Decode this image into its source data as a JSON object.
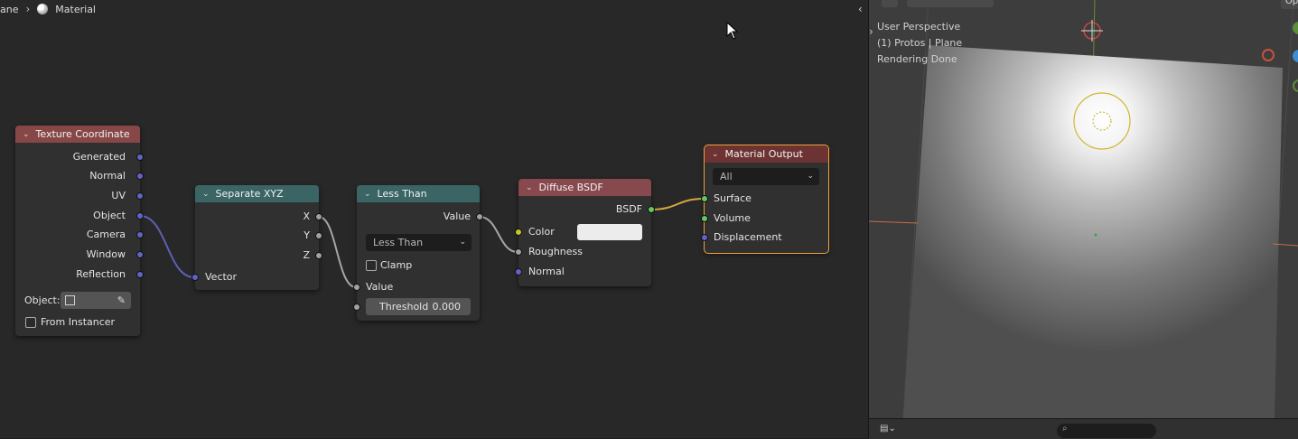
{
  "breadcrumb": {
    "object": "ane",
    "material": "Material"
  },
  "nodes": {
    "texcoord": {
      "title": "Texture Coordinate",
      "outputs": [
        "Generated",
        "Normal",
        "UV",
        "Object",
        "Camera",
        "Window",
        "Reflection"
      ],
      "object_label": "Object:",
      "from_instancer": "From Instancer"
    },
    "separate": {
      "title": "Separate XYZ",
      "outputs": [
        "X",
        "Y",
        "Z"
      ],
      "input": "Vector"
    },
    "lessthan": {
      "title": "Less Than",
      "output": "Value",
      "operation": "Less Than",
      "clamp": "Clamp",
      "input_value": "Value",
      "threshold_label": "Threshold",
      "threshold_value": "0.000"
    },
    "diffuse": {
      "title": "Diffuse BSDF",
      "output": "BSDF",
      "inputs": [
        "Color",
        "Roughness",
        "Normal"
      ]
    },
    "output": {
      "title": "Material Output",
      "target": "All",
      "inputs": [
        "Surface",
        "Volume",
        "Displacement"
      ]
    }
  },
  "viewport": {
    "line1": "User Perspective",
    "line2": "(1) Protos | Plane",
    "line3": "Rendering Done",
    "corner_label": "Op"
  },
  "colors": {
    "vector_socket": "#6363c7",
    "float_socket": "#a1a1a1",
    "color_socket": "#c7c729",
    "shader_socket": "#63c763",
    "selected_outline": "#f0a23c",
    "link_vector": "#5f5fb8",
    "link_float": "#a6a6a6",
    "link_shader": "#d9a540"
  },
  "icons": [
    "chevron-right-icon",
    "material-icon",
    "eyedropper-icon",
    "object-icon",
    "search-icon",
    "editor-type-icon",
    "light-icon",
    "camera-gizmo-icon"
  ]
}
